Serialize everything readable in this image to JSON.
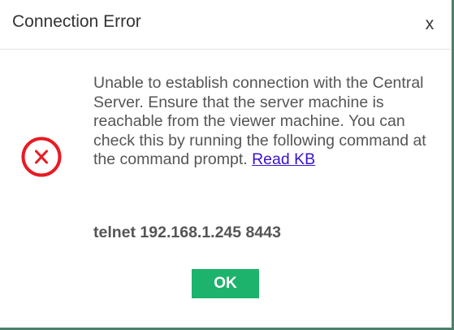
{
  "dialog": {
    "title": "Connection Error",
    "close_label": "x",
    "icon": "error-x-circle-icon",
    "message": "Unable to establish connection with the Central Server. Ensure that the server machine is reachable from the viewer machine. You can check this by running the following command at the command prompt.",
    "link_text": "Read KB",
    "command": "telnet 192.168.1.245 8443",
    "ok_label": "OK"
  },
  "colors": {
    "error_red": "#e81b23",
    "ok_green": "#1db36c",
    "link": "#3b12c9",
    "backdrop": "#4f7f6d"
  }
}
